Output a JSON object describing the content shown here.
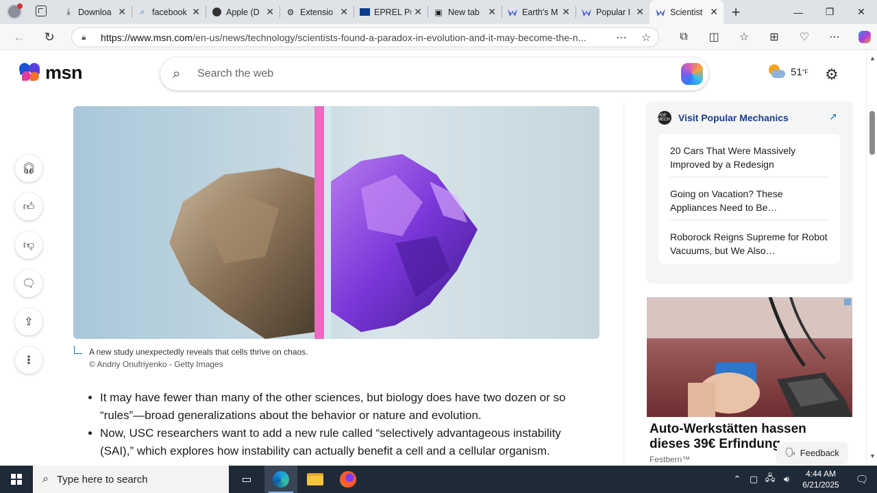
{
  "browser": {
    "tabs": [
      {
        "title": "Downloa",
        "icon": "download-icon"
      },
      {
        "title": "facebook",
        "icon": "search-icon"
      },
      {
        "title": "Apple (D",
        "icon": "apple-icon"
      },
      {
        "title": "Extensio",
        "icon": "extension-icon"
      },
      {
        "title": "EPREL Pu",
        "icon": "eu-flag-icon"
      },
      {
        "title": "New tab",
        "icon": "newtab-icon"
      },
      {
        "title": "Earth's M",
        "icon": "msn-icon"
      },
      {
        "title": "Popular I",
        "icon": "msn-icon"
      },
      {
        "title": "Scientist",
        "icon": "msn-icon",
        "active": true
      }
    ],
    "url_domain": "https://www.msn.com",
    "url_path": "/en-us/news/technology/scientists-found-a-paradox-in-evolution-and-it-may-become-the-n..."
  },
  "msn": {
    "logo_text": "msn",
    "search_placeholder": "Search the web",
    "weather_temp": "51",
    "weather_unit": "°F"
  },
  "article": {
    "caption": "A new study unexpectedly reveals that cells thrive on chaos.",
    "credit": "© Andriy Onufriyenko - Getty Images",
    "bullets": [
      "It may have fewer than many of the other sciences, but biology does have two dozen or so “rules”—broad generalizations about the behavior or nature and evolution.",
      "Now, USC researchers want to add a new rule called “selectively advantageous instability (SAI),” which explores how instability can actually benefit a cell and a cellular organism."
    ]
  },
  "sidebar": {
    "source_link": "Visit Popular Mechanics",
    "source_logo": "POP MECH",
    "items": [
      "20 Cars That Were Massively Improved by a Redesign",
      "Going on Vacation? These Appliances Need to Be…",
      "Roborock Reigns Supreme for Robot Vacuums, but We Also…"
    ]
  },
  "ad": {
    "title": "Auto-Werkstätten hassen dieses 39€ Erfindung",
    "source": "Festbern™"
  },
  "feedback_label": "Feedback",
  "taskbar": {
    "search_placeholder": "Type here to search",
    "time": "4:44 AM",
    "date": "6/21/2025"
  }
}
